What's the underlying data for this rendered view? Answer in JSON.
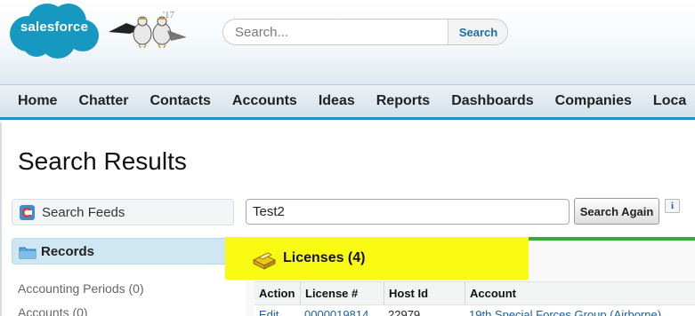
{
  "header": {
    "logo_text": "salesforce",
    "release_year": "'17",
    "search_placeholder": "Search...",
    "search_button": "Search"
  },
  "nav": {
    "tabs": [
      "Home",
      "Chatter",
      "Contacts",
      "Accounts",
      "Ideas",
      "Reports",
      "Dashboards",
      "Companies",
      "Loca"
    ]
  },
  "page": {
    "title": "Search Results"
  },
  "sidebar": {
    "feeds_label": "Search Feeds",
    "records_label": "Records",
    "items": [
      "Accounting Periods (0)",
      "Accounts (0)"
    ]
  },
  "search": {
    "query": "Test2",
    "again_button": "Search Again",
    "info_label": "i"
  },
  "results": {
    "section_title": "Licenses (4)",
    "columns": [
      "Action",
      "License #",
      "Host Id",
      "Account"
    ],
    "rows": [
      {
        "action": "Edit",
        "license": "0000019814",
        "host_id": "22979",
        "account": "19th Special Forces Group (Airborne)"
      }
    ]
  },
  "colors": {
    "nav_accent": "#1f8fc9",
    "logo_blue": "#1798c1",
    "highlight": "#fafb12",
    "section_bar": "#3da83d",
    "link": "#1a5fa0"
  }
}
